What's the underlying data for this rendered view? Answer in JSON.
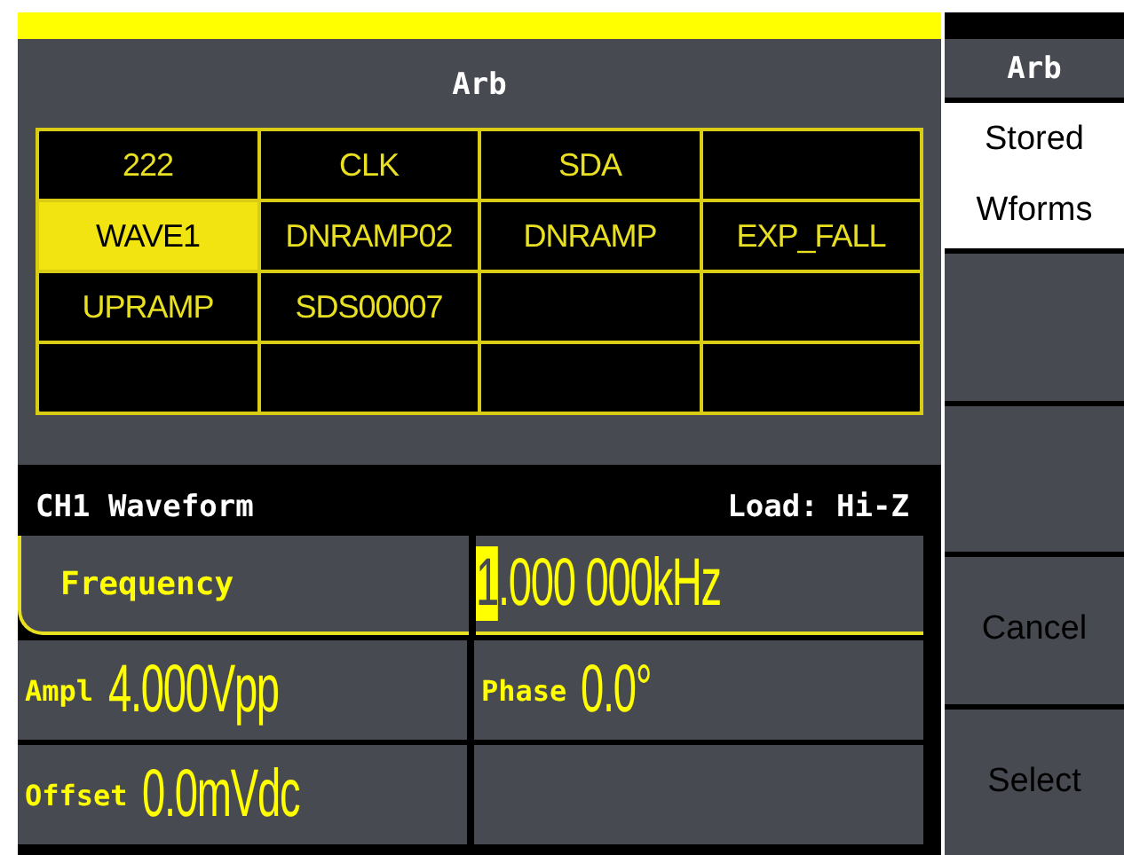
{
  "screen": {
    "title": "Arb"
  },
  "file_grid": {
    "rows": [
      [
        {
          "name": "222",
          "selected": false
        },
        {
          "name": "CLK",
          "selected": false
        },
        {
          "name": "SDA",
          "selected": false
        },
        {
          "selected": false
        }
      ],
      [
        {
          "name": "WAVE1",
          "selected": true
        },
        {
          "name": "DNRAMP02",
          "selected": false
        },
        {
          "name": "DNRAMP",
          "selected": false
        },
        {
          "name": "EXP_FALL",
          "selected": false
        }
      ],
      [
        {
          "name": "UPRAMP",
          "selected": false
        },
        {
          "name": "SDS00007",
          "selected": false
        },
        {
          "selected": false
        },
        {
          "selected": false
        }
      ],
      [
        {
          "selected": false
        },
        {
          "selected": false
        },
        {
          "selected": false
        },
        {
          "selected": false
        }
      ]
    ]
  },
  "channel": {
    "title": "CH1 Waveform",
    "load": "Load: Hi-Z"
  },
  "param_rows": [
    [
      {
        "kind": "label",
        "label": "Frequency",
        "selected": true
      },
      {
        "kind": "value",
        "value": "1.000 000kHz",
        "selected": true,
        "editing": true
      }
    ],
    [
      {
        "kind": "param",
        "label": "Ampl",
        "value": "4.000Vpp",
        "selected": false,
        "editing": false
      },
      {
        "kind": "param",
        "label": "Phase",
        "value": "0.0°",
        "selected": false,
        "editing": false
      }
    ],
    [
      {
        "kind": "param",
        "label": "Offset",
        "value": "0.0mVdc",
        "selected": false,
        "editing": false
      },
      {
        "kind": "empty",
        "selected": false
      }
    ]
  ],
  "softkeys": {
    "title": "Arb",
    "keys": [
      {
        "label": "Stored Wforms",
        "selected": true
      },
      {
        "selected": false
      },
      {
        "selected": false
      },
      {
        "label": "Cancel",
        "selected": false
      },
      {
        "label": "Select",
        "selected": false
      }
    ]
  }
}
